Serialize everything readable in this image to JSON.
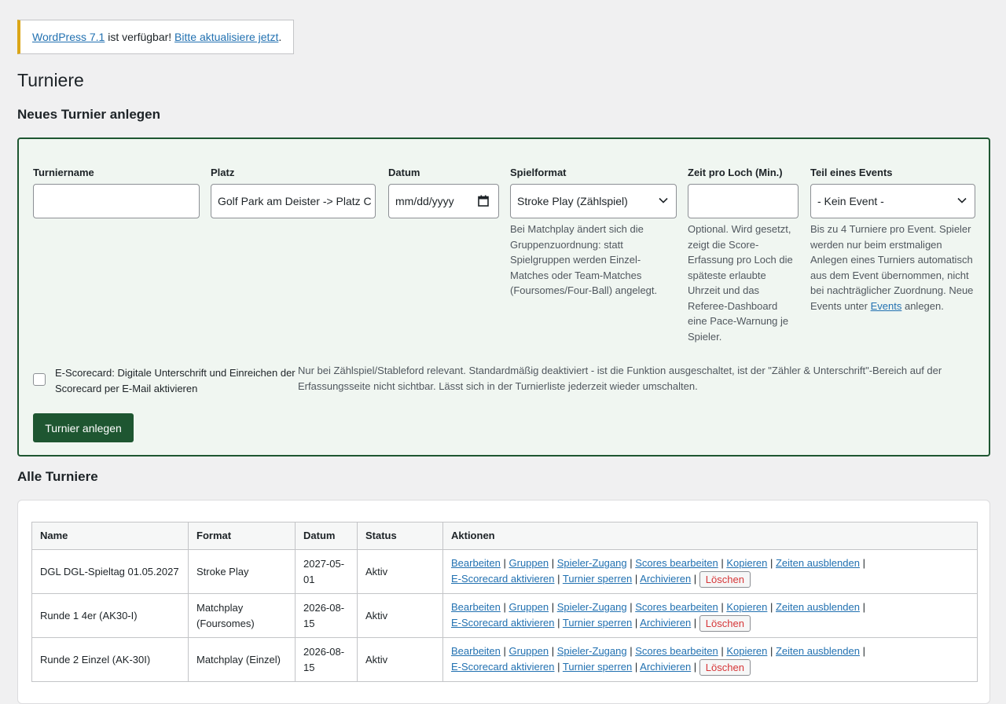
{
  "notice": {
    "link1": "WordPress 7.1",
    "text": " ist verfügbar! ",
    "link2": "Bitte aktualisiere jetzt",
    "end": "."
  },
  "page_title": "Turniere",
  "new_section_title": "Neues Turnier anlegen",
  "form": {
    "name": {
      "label": "Turniername",
      "value": ""
    },
    "course": {
      "label": "Platz",
      "value": "Golf Park am Deister -> Platz C"
    },
    "date": {
      "label": "Datum",
      "placeholder": "mm/dd/yyyy"
    },
    "format": {
      "label": "Spielformat",
      "value": "Stroke Play (Zählspiel)",
      "help": "Bei Matchplay ändert sich die Gruppenzuordnung: statt Spielgruppen werden Einzel-Matches oder Team-Matches (Foursomes/Four-Ball) angelegt."
    },
    "time_per_hole": {
      "label": "Zeit pro Loch (Min.)",
      "value": "",
      "help": "Optional. Wird gesetzt, zeigt die Score-Erfassung pro Loch die späteste erlaubte Uhrzeit und das Referee-Dashboard eine Pace-Warnung je Spieler."
    },
    "event": {
      "label": "Teil eines Events",
      "value": "- Kein Event -",
      "help_before": "Bis zu 4 Turniere pro Event. Spieler werden nur beim erstmaligen Anlegen eines Turniers automatisch aus dem Event übernommen, nicht bei nachträglicher Zuordnung. Neue Events unter ",
      "help_link": "Events",
      "help_after": " anlegen."
    },
    "escorecard": {
      "label": "E-Scorecard: Digitale Unterschrift und Einreichen der Scorecard per E-Mail aktivieren",
      "checked": false,
      "help": "Nur bei Zählspiel/Stableford relevant. Standardmäßig deaktiviert - ist die Funktion ausgeschaltet, ist der \"Zähler & Unterschrift\"-Bereich auf der Erfassungsseite nicht sichtbar. Lässt sich in der Turnierliste jederzeit wieder umschalten."
    },
    "submit_label": "Turnier anlegen"
  },
  "list_section_title": "Alle Turniere",
  "table": {
    "headers": {
      "name": "Name",
      "format": "Format",
      "date": "Datum",
      "status": "Status",
      "actions": "Aktionen"
    },
    "actions": {
      "edit": "Bearbeiten",
      "groups": "Gruppen",
      "player_access": "Spieler-Zugang",
      "edit_scores": "Scores bearbeiten",
      "copy": "Kopieren",
      "hide_times": "Zeiten ausblenden",
      "escorecard": "E-Scorecard aktivieren",
      "lock": "Turnier sperren",
      "archive": "Archivieren",
      "delete": "Löschen"
    },
    "rows": [
      {
        "name": "DGL DGL-Spieltag 01.05.2027",
        "format": "Stroke Play",
        "date": "2027-05-01",
        "status": "Aktiv"
      },
      {
        "name": "Runde 1 4er (AK30-I)",
        "format": "Matchplay (Foursomes)",
        "date": "2026-08-15",
        "status": "Aktiv"
      },
      {
        "name": "Runde 2 Einzel (AK-30I)",
        "format": "Matchplay (Einzel)",
        "date": "2026-08-15",
        "status": "Aktiv"
      }
    ]
  },
  "colors": {
    "primary": "#1e5631",
    "panel_bg": "#f0f6f1",
    "link": "#2271b1",
    "delete": "#d63638",
    "notice_accent": "#dba617"
  },
  "icons": {
    "select": "chevron-down-icon",
    "date": "calendar-icon"
  }
}
